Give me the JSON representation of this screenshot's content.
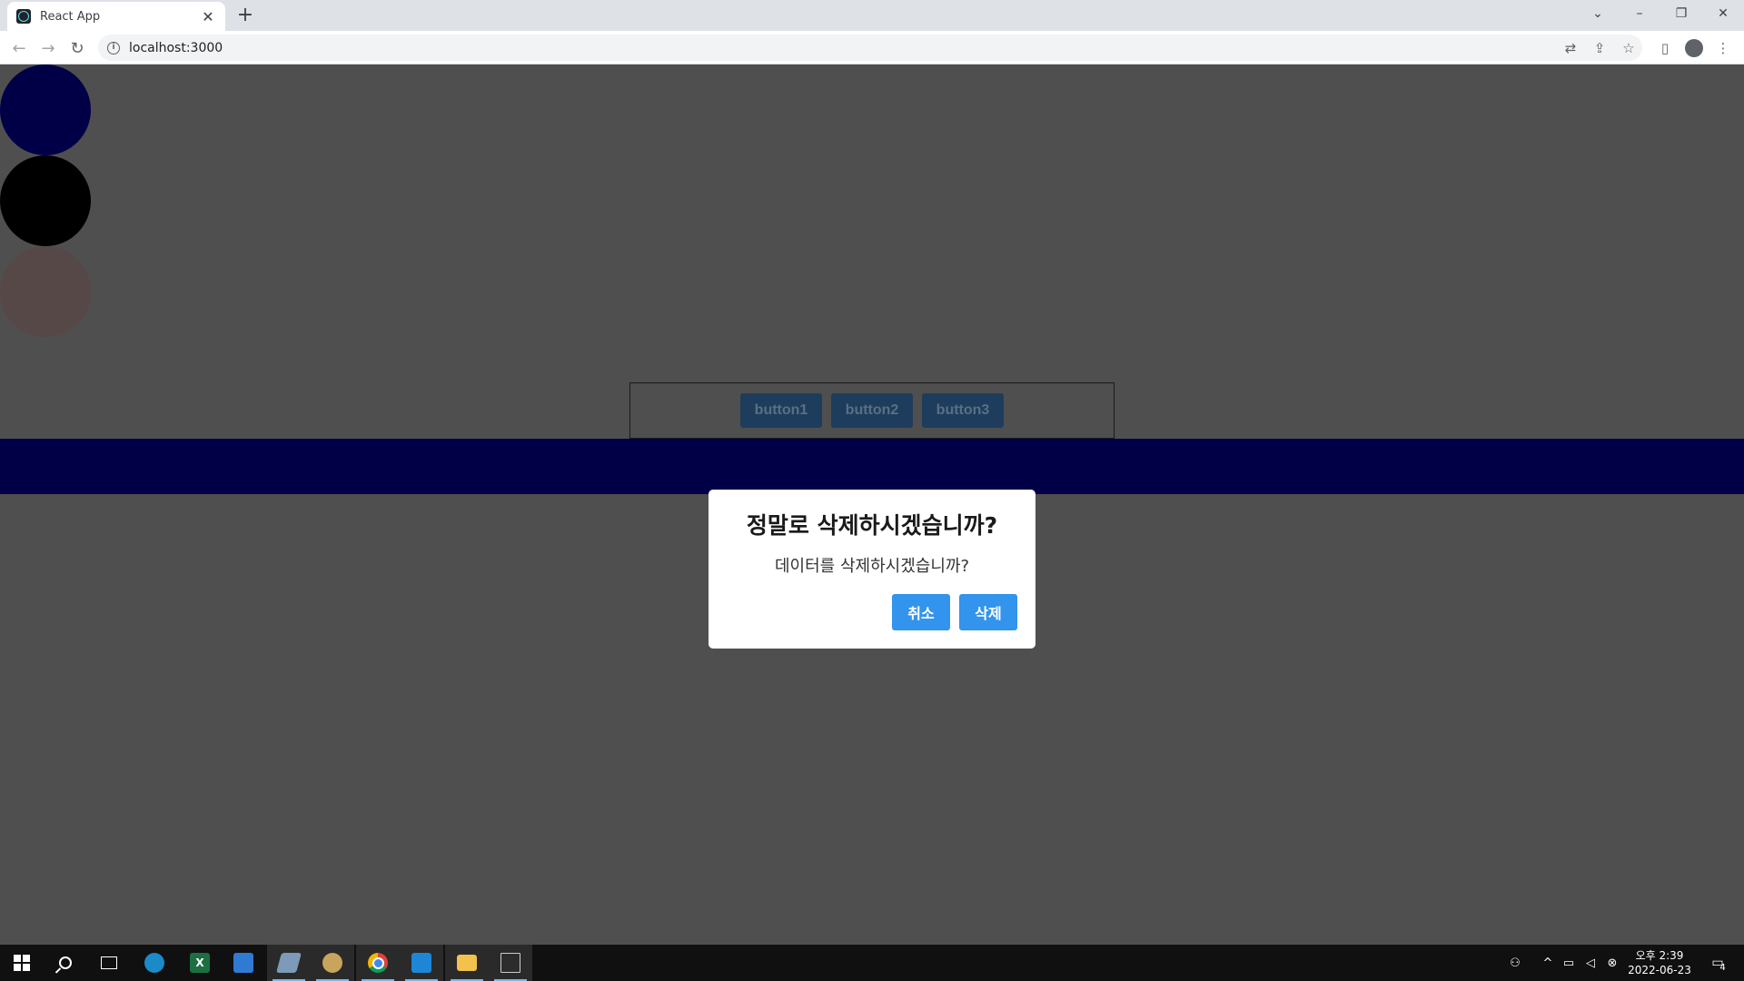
{
  "browser": {
    "tab_title": "React App",
    "tab_close": "✕",
    "new_tab": "+",
    "url": "localhost:3000",
    "nav": {
      "back": "←",
      "forward": "→",
      "reload": "↻"
    },
    "window_controls": {
      "tabs_menu": "⌄",
      "minimize": "–",
      "restore": "❐",
      "close": "✕"
    },
    "toolbar_icons": {
      "translate": "⇄",
      "share": "⇪",
      "bookmark": "☆",
      "side_panel": "▯",
      "menu": "⋮"
    }
  },
  "page": {
    "circles": [
      {
        "color": "#010047"
      },
      {
        "color": "#000000"
      },
      {
        "color": "#574848"
      }
    ],
    "panel_buttons": [
      "button1",
      "button2",
      "button3"
    ],
    "band_color": "#010047"
  },
  "modal": {
    "title": "정말로 삭제하시겠습니까?",
    "message": "데이터를 삭제하시겠습니까?",
    "cancel_label": "취소",
    "delete_label": "삭제",
    "button_color": "#3294ec"
  },
  "taskbar": {
    "clock_period_time": "오후 2:39",
    "clock_date": "2022-06-23",
    "notification_count": "4",
    "apps": [
      {
        "name": "start-icon"
      },
      {
        "name": "search-icon"
      },
      {
        "name": "task-view-icon"
      },
      {
        "name": "messenger-app-icon",
        "color": "#1b8ac9"
      },
      {
        "name": "excel-app-icon",
        "color": "#1d6f42",
        "glyph": "X"
      },
      {
        "name": "notepad-app-icon",
        "color": "#2f7bd4"
      },
      {
        "name": "pen-app-icon",
        "color": "#7d9bb8"
      },
      {
        "name": "paint-app-icon",
        "color": "#c9a45c"
      },
      {
        "name": "chrome-app-icon"
      },
      {
        "name": "vscode-app-icon",
        "color": "#1e86d6"
      },
      {
        "name": "file-explorer-app-icon",
        "color": "#f2c14e"
      },
      {
        "name": "terminal-app-icon",
        "color": "#2c2c2c"
      }
    ]
  }
}
